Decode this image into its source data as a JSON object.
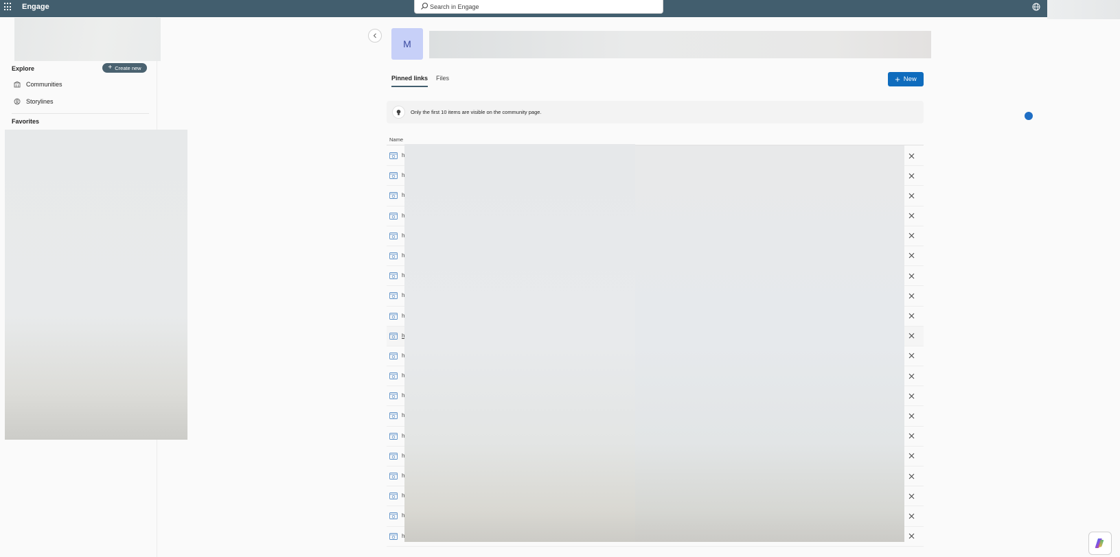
{
  "topbar": {
    "app_title": "Engage",
    "search_placeholder": "Search in Engage"
  },
  "sidebar": {
    "explore_label": "Explore",
    "create_new_label": "Create new",
    "nav_items": [
      {
        "label": "Communities",
        "icon": "communities-icon"
      },
      {
        "label": "Storylines",
        "icon": "storylines-icon"
      }
    ],
    "favorites_label": "Favorites"
  },
  "community": {
    "avatar_letter": "M"
  },
  "tabs": [
    {
      "label": "Pinned links",
      "active": true
    },
    {
      "label": "Files",
      "active": false
    }
  ],
  "new_button_label": "New",
  "info_message": "Only the first 10 items are visible on the community page.",
  "table": {
    "column_name": "Name",
    "rows": [
      "h",
      "h",
      "h",
      "h",
      "h",
      "h",
      "h",
      "h",
      "h",
      "h",
      "h",
      "h",
      "h",
      "h",
      "h",
      "h",
      "h",
      "h",
      "h",
      "h"
    ]
  },
  "colors": {
    "topbar": "#425e6e",
    "accent_blue": "#0f6cbd",
    "avatar_bg": "#c7d0f8"
  }
}
